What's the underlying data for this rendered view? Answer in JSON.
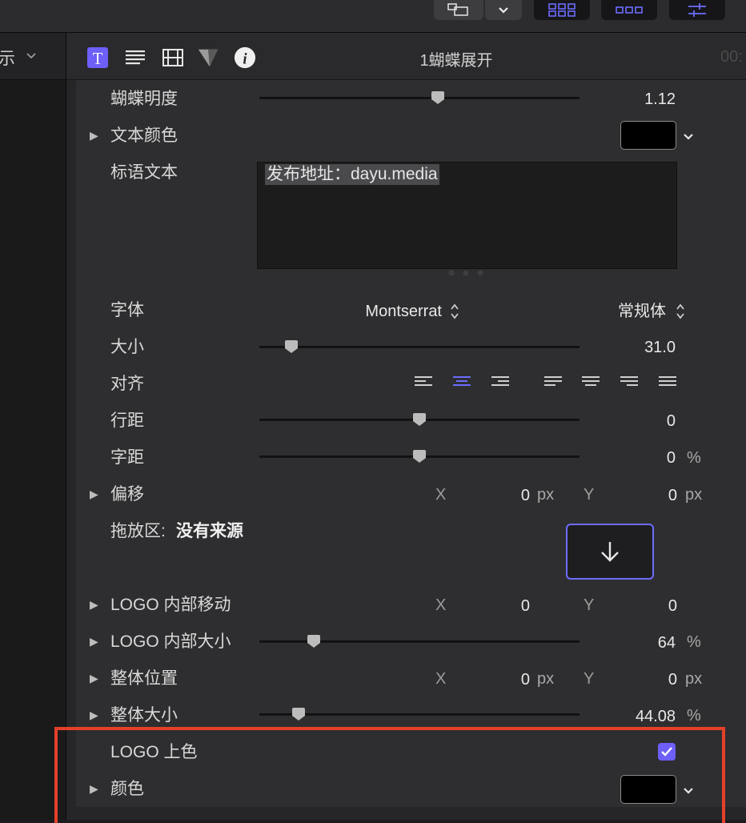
{
  "sidebar": {
    "header_label": "示"
  },
  "inspector": {
    "title": "1蝴蝶展开",
    "timecode": "00:",
    "tabs": [
      {
        "name": "text"
      },
      {
        "name": "paragraph"
      },
      {
        "name": "video"
      },
      {
        "name": "shape"
      },
      {
        "name": "info"
      }
    ],
    "rows": {
      "butterfly_brightness": {
        "label": "蝴蝶明度",
        "value": "1.12",
        "slider_fraction": 0.5
      },
      "text_color": {
        "label": "文本颜色",
        "swatch_color": "#000000"
      },
      "slogan_text": {
        "label": "标语文本",
        "value": "发布地址：dayu.media"
      },
      "font": {
        "label": "字体",
        "family": "Montserrat",
        "style": "常规体"
      },
      "size": {
        "label": "大小",
        "value": "31.0",
        "slider_fraction": 0.1
      },
      "align": {
        "label": "对齐"
      },
      "line_spacing": {
        "label": "行距",
        "value": "0",
        "slider_fraction": 0.5
      },
      "tracking": {
        "label": "字距",
        "value": "0",
        "unit": "%",
        "slider_fraction": 0.5
      },
      "offset": {
        "label": "偏移",
        "x_label": "X",
        "x_value": "0",
        "x_unit": "px",
        "y_label": "Y",
        "y_value": "0",
        "y_unit": "px"
      },
      "drop_zone": {
        "label": "拖放区:",
        "source": "没有来源"
      },
      "logo_move": {
        "label": "LOGO 内部移动",
        "x_label": "X",
        "x_value": "0",
        "y_label": "Y",
        "y_value": "0"
      },
      "logo_size": {
        "label": "LOGO 内部大小",
        "value": "64",
        "unit": "%",
        "slider_fraction": 0.16
      },
      "position": {
        "label": "整体位置",
        "x_label": "X",
        "x_value": "0",
        "x_unit": "px",
        "y_label": "Y",
        "y_value": "0",
        "y_unit": "px"
      },
      "overall_size": {
        "label": "整体大小",
        "value": "44.08",
        "unit": "%",
        "slider_fraction": 0.12
      },
      "logo_tint": {
        "label": "LOGO 上色",
        "checked": true
      },
      "color": {
        "label": "颜色",
        "swatch_color": "#000000"
      }
    }
  },
  "colors": {
    "accent": "#6d5ff7",
    "highlight": "#e5402a"
  }
}
